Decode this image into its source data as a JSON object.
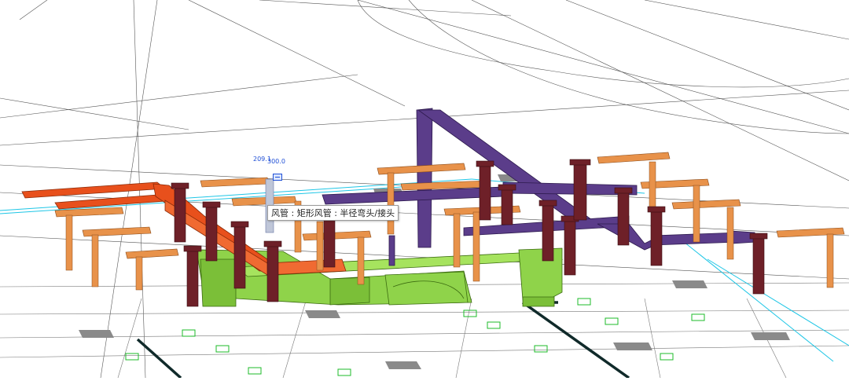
{
  "viewport": {
    "title": "",
    "tooltip": "风管 : 矩形风管 : 半径弯头/接头",
    "dimension_text_a": "209.1",
    "dimension_text_b": "300.0"
  },
  "colors": {
    "background": "#ffffff",
    "support_beam": "#e8924a",
    "support_beam_dark": "#b8652a",
    "column": "#6e2028",
    "column_light": "#9a3a3f",
    "duct_red": "#e8501c",
    "duct_green": "#8fd34a",
    "duct_purple": "#5b3d8a",
    "grid_line": "#555555",
    "equipment_pad": "#8a8a8a",
    "cyan_line": "#1ec6e6",
    "blue_annotation": "#1f4fd6"
  }
}
